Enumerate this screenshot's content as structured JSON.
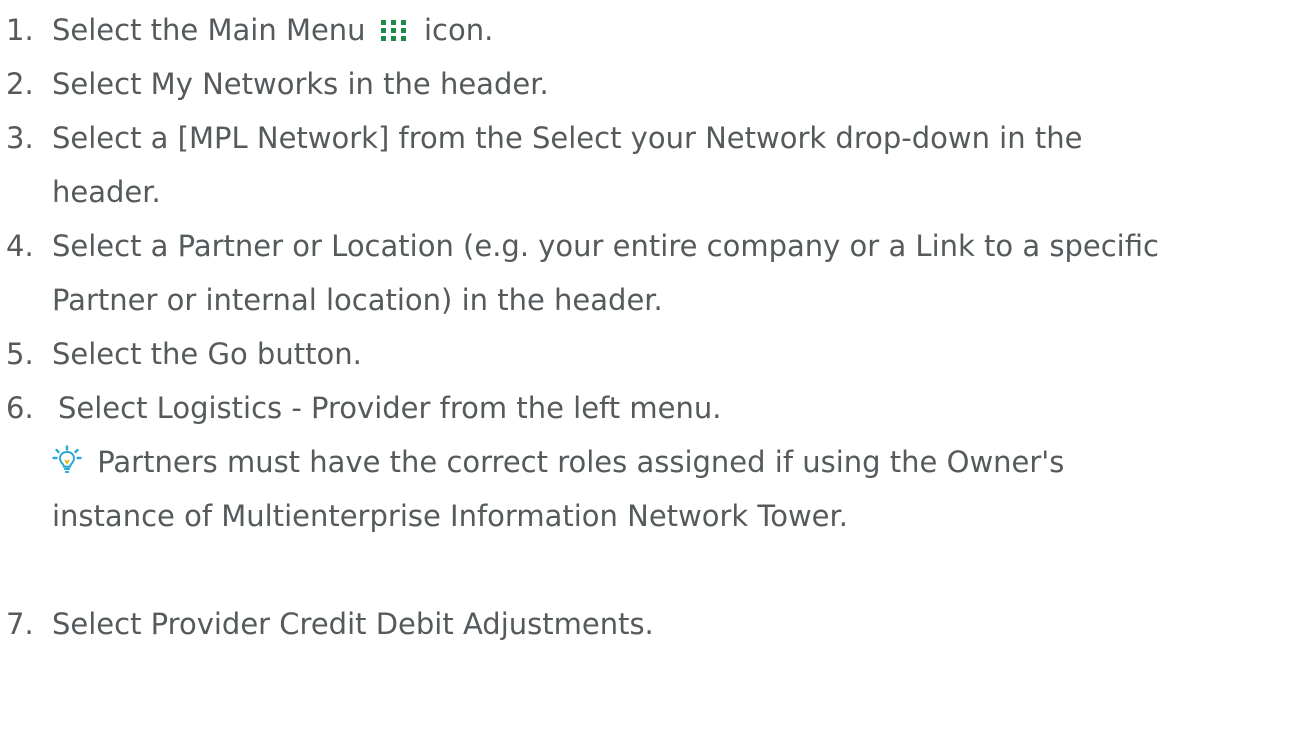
{
  "steps": [
    {
      "num": "1.",
      "before_icon": "Select the Main Menu",
      "icon": "grid-menu-icon",
      "after_icon": "icon."
    },
    {
      "num": "2.",
      "text": "Select My Networks in the header."
    },
    {
      "num": "3.",
      "line1": "Select a [MPL Network] from the Select your Network drop-down in the",
      "line2": "header."
    },
    {
      "num": "4.",
      "line1": "Select a Partner or Location (e.g. your entire company or a Link to a specific",
      "line2": "Partner or internal location) in the header."
    },
    {
      "num": "5.",
      "text": "Select the Go button."
    },
    {
      "num": "6.",
      "text": "Select Logistics - Provider from the left menu.",
      "tip_icon": "lightbulb-icon",
      "tip_line1": "Partners must have the correct roles assigned if using the Owner's",
      "tip_line2": "instance of Multienterprise Information Network Tower."
    },
    {
      "num": "7.",
      "text": "Select Provider Credit Debit Adjustments."
    }
  ],
  "colors": {
    "text": "#555a5c",
    "grid_icon": "#1e8a4a",
    "tip_icon": "#2aa8d8",
    "tip_bulb": "#e8b400"
  }
}
